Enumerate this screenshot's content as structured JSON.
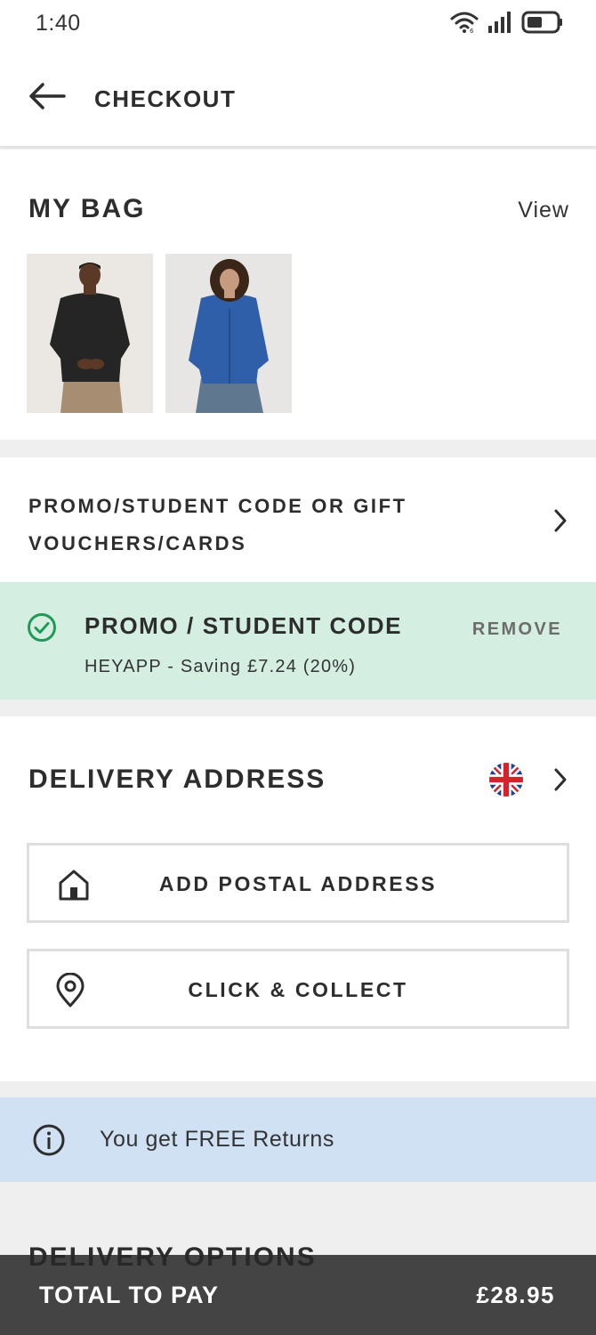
{
  "status_bar": {
    "time": "1:40"
  },
  "header": {
    "title": "CHECKOUT"
  },
  "bag": {
    "heading": "MY BAG",
    "view_label": "View",
    "items": [
      {
        "name": "man-black-shirt"
      },
      {
        "name": "woman-blue-cardigan"
      }
    ]
  },
  "promo_link": {
    "label": "PROMO/STUDENT CODE OR GIFT VOUCHERS/CARDS"
  },
  "promo_applied": {
    "title": "PROMO / STUDENT CODE",
    "remove_label": "REMOVE",
    "saving_text": "HEYAPP - Saving £7.24 (20%)"
  },
  "delivery": {
    "heading": "DELIVERY ADDRESS",
    "country_icon": "uk-flag-icon",
    "add_postal_label": "ADD POSTAL ADDRESS",
    "click_collect_label": "CLICK & COLLECT"
  },
  "returns": {
    "text": "You get FREE Returns"
  },
  "delivery_options": {
    "heading": "DELIVERY OPTIONS"
  },
  "total": {
    "label": "TOTAL TO PAY",
    "amount": "£28.95"
  },
  "colors": {
    "promo_applied_bg": "#d4efe1",
    "returns_bg": "#cfe1f3",
    "check_green": "#1f9a55",
    "total_bar_bg": "#2b2b2b"
  }
}
